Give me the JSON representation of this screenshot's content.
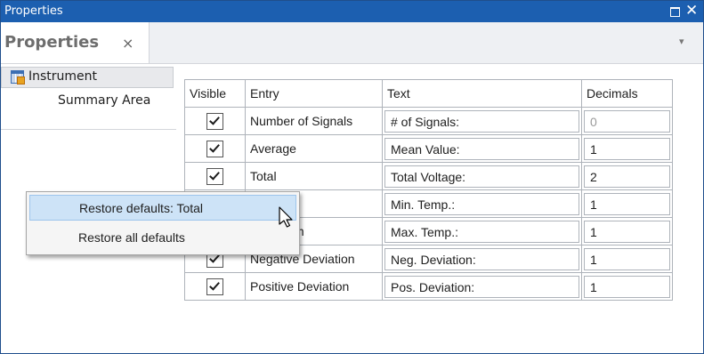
{
  "window": {
    "title": "Properties",
    "maximize_icon": "maximize-icon",
    "close_icon": "close-icon"
  },
  "tab": {
    "label": "Properties",
    "close_glyph": "×"
  },
  "menu_arrow_glyph": "▾",
  "sidebar": {
    "items": [
      {
        "label": "Instrument",
        "icon": "table-grid-icon"
      },
      {
        "label": "Summary Area"
      }
    ]
  },
  "table": {
    "headers": {
      "visible": "Visible",
      "entry": "Entry",
      "text": "Text",
      "decimals": "Decimals"
    },
    "rows": [
      {
        "visible": true,
        "entry": "Number of Signals",
        "text": "# of Signals:",
        "decimals": "0",
        "decimals_disabled": true
      },
      {
        "visible": true,
        "entry": "Average",
        "text": "Mean Value:",
        "decimals": "1"
      },
      {
        "visible": true,
        "entry": "Total",
        "text": "Total Voltage:",
        "decimals": "2"
      },
      {
        "visible": true,
        "entry": "Minimum",
        "text": "Min. Temp.:",
        "decimals": "1"
      },
      {
        "visible": true,
        "entry": "Maximum",
        "text": "Max. Temp.:",
        "decimals": "1"
      },
      {
        "visible": true,
        "entry": "Negative Deviation",
        "text": "Neg. Deviation:",
        "decimals": "1"
      },
      {
        "visible": true,
        "entry": "Positive Deviation",
        "text": "Pos. Deviation:",
        "decimals": "1"
      }
    ]
  },
  "context_menu": {
    "items": [
      {
        "label": "Restore defaults: Total",
        "highlighted": true
      },
      {
        "label": "Restore all defaults"
      }
    ]
  },
  "colors": {
    "titlebar": "#1c5fb0",
    "menu_highlight": "#cde3f7"
  }
}
